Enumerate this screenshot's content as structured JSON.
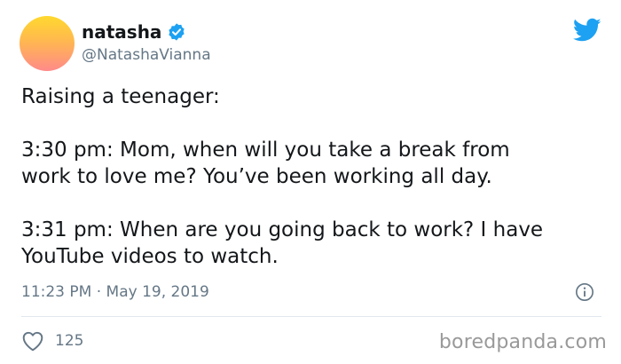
{
  "author": {
    "display_name": "natasha",
    "handle": "@NatashaVianna",
    "verified_icon": "verified-badge-icon",
    "avatar_colors": [
      "#ffd92e",
      "#ffb84f",
      "#ff8a8a"
    ]
  },
  "brand": {
    "icon": "twitter-bird-icon",
    "color": "#1da1f2"
  },
  "tweet": {
    "line1": "Raising a teenager:",
    "line2": "3:30 pm: Mom, when will you take a break from",
    "line3": "work to love me? You’ve been working all day.",
    "line4": "3:31 pm: When are you going back to work? I have",
    "line5": "YouTube videos to watch."
  },
  "meta": {
    "timestamp": "11:23 PM · May 19, 2019",
    "info_icon": "info-icon"
  },
  "engagement": {
    "like_icon": "heart-icon",
    "like_count": "125"
  },
  "watermark": "boredpanda.com"
}
